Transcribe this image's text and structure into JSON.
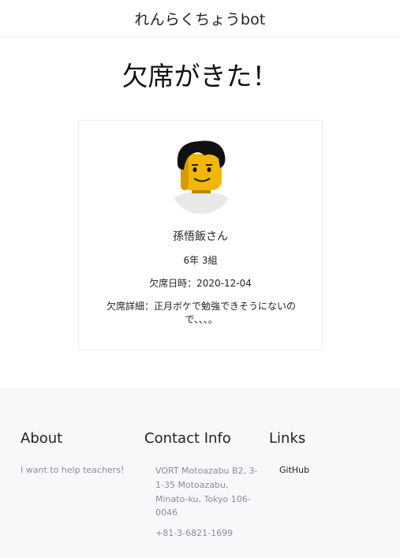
{
  "navbar": {
    "brand": "れんらくちょうbot"
  },
  "page": {
    "title": "欠席がきた！"
  },
  "card": {
    "avatar_icon": "lego-minifigure-avatar",
    "name": "孫悟飯さん",
    "class": "6年 3組",
    "date": "欠席日時：2020-12-04",
    "detail": "欠席詳細：正月ボケで勉強できそうにないので、、、。"
  },
  "footer": {
    "about": {
      "heading": "About",
      "text": "I want to help teachers!"
    },
    "contact": {
      "heading": "Contact Info",
      "address": "VORT Motoazabu B2, 3-1-35 Motoazabu, Minato-ku, Tokyo 106-0046",
      "phone": "+81-3-6821-1699"
    },
    "links": {
      "heading": "Links",
      "items": [
        {
          "label": "GitHub"
        }
      ]
    }
  }
}
